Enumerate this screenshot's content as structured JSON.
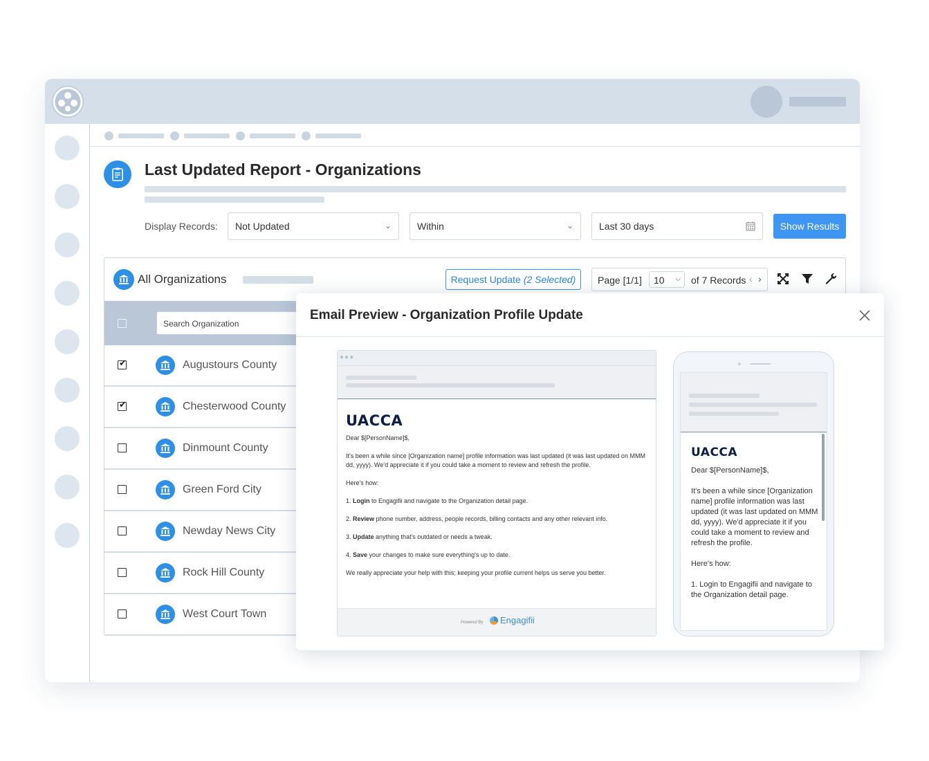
{
  "breadcrumb": {
    "count": 4
  },
  "page": {
    "title": "Last Updated Report - Organizations"
  },
  "filters": {
    "label": "Display Records:",
    "status_value": "Not Updated",
    "range_value": "Within",
    "date_value": "Last 30 days",
    "show_button": "Show Results"
  },
  "panel": {
    "title": "All Organizations",
    "request_label": "Request Update",
    "request_selected": "(2 Selected)",
    "page_label": "Page [1/1]",
    "page_size": "10",
    "records_label": "of 7 Records",
    "search_placeholder": "Search Organization"
  },
  "organizations": [
    {
      "name": "Augustours County",
      "checked": true
    },
    {
      "name": "Chesterwood County",
      "checked": true
    },
    {
      "name": "Dinmount County",
      "checked": false
    },
    {
      "name": "Green Ford City",
      "checked": false
    },
    {
      "name": "Newday News City",
      "checked": false
    },
    {
      "name": "Rock Hill County",
      "checked": false
    },
    {
      "name": "West Court Town",
      "checked": false
    }
  ],
  "modal": {
    "title": "Email Preview - Organization Profile Update",
    "brand": "UACCA",
    "greeting": "Dear $[PersonName]$,",
    "intro": "It's been a while since [Organization name] profile information was last updated (it was last updated on MMM dd, yyyy). We'd appreciate it if you could take a moment to review and refresh the profile.",
    "howto": "Here's how:",
    "step1_bold": "Login",
    "step1_rest": " to Engagifii and navigate to the Organization detail page.",
    "step2_bold": "Review",
    "step2_rest": " phone number, address, people records, billing contacts and any other relevant info.",
    "step3_bold": "Update",
    "step3_rest": " anything that's outdated or needs a tweak.",
    "step4_bold": "Save",
    "step4_rest": " your changes to make sure everything's up to date.",
    "closing": "We really appreciate your help with this; keeping your profile current helps us serve you better.",
    "powered_by": "Powered By",
    "engagifii": "Engagifii",
    "mobile_intro": "It's been a while since [Organization name] profile information was last updated (it was last updated on MMM dd, yyyy). We'd appreciate it if you could take a moment to review and refresh the profile.",
    "mobile_step1": "1. Login to Engagifii and navigate to the Organization detail page."
  },
  "colors": {
    "accent": "#3e95f2",
    "topbar": "#d4dfea",
    "table_head": "#b9c7d7",
    "brand_navy": "#0b1f4a"
  }
}
